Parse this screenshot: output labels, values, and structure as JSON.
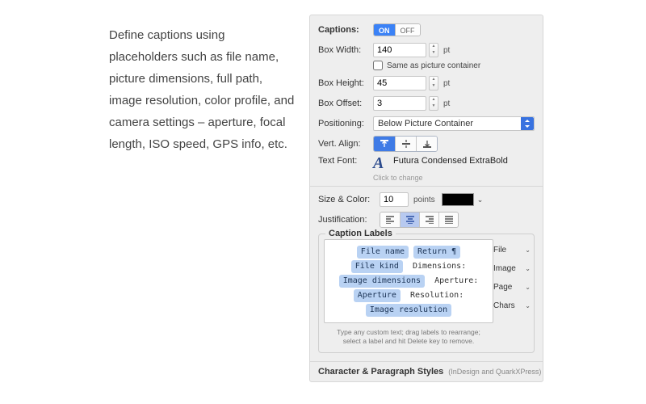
{
  "description": "Define captions using placeholders such as file name, picture dimensions, full path, image resolution, color profile, and camera settings – aperture, focal length, ISO speed, GPS info, etc.",
  "captions": {
    "label": "Captions:",
    "toggle": {
      "on": "ON",
      "off": "OFF",
      "state": "on"
    },
    "box_width": {
      "label": "Box Width:",
      "value": "140",
      "unit": "pt"
    },
    "same_as_container": {
      "label": "Same as picture container",
      "checked": false
    },
    "box_height": {
      "label": "Box Height:",
      "value": "45",
      "unit": "pt"
    },
    "box_offset": {
      "label": "Box Offset:",
      "value": "3",
      "unit": "pt"
    },
    "positioning": {
      "label": "Positioning:",
      "value": "Below Picture Container"
    },
    "vert_align": {
      "label": "Vert. Align:"
    },
    "text_font": {
      "label": "Text Font:",
      "value": "Futura Condensed ExtraBold",
      "hint": "Click to change"
    },
    "size_color": {
      "label": "Size & Color:",
      "size": "10",
      "unit": "points",
      "color": "#000000"
    },
    "justification": {
      "label": "Justification:"
    }
  },
  "caption_labels": {
    "title": "Caption Labels",
    "tokens": [
      {
        "type": "chip",
        "text": "File name"
      },
      {
        "type": "chip",
        "text": "Return ¶"
      },
      {
        "type": "break"
      },
      {
        "type": "chip",
        "text": "File kind"
      },
      {
        "type": "static",
        "text": "Dimensions:"
      },
      {
        "type": "break"
      },
      {
        "type": "chip",
        "text": "Image dimensions"
      },
      {
        "type": "static",
        "text": "Aperture:"
      },
      {
        "type": "break"
      },
      {
        "type": "chip",
        "text": "Aperture"
      },
      {
        "type": "static",
        "text": "Resolution:"
      },
      {
        "type": "break"
      },
      {
        "type": "chip",
        "text": "Image resolution"
      }
    ],
    "hint": "Type any custom text; drag labels to rearrange; select a label and hit Delete key to remove.",
    "side_menus": [
      "File",
      "Image",
      "Page",
      "Chars"
    ]
  },
  "footer": {
    "title": "Character & Paragraph Styles",
    "note": "(InDesign and QuarkXPress)"
  }
}
